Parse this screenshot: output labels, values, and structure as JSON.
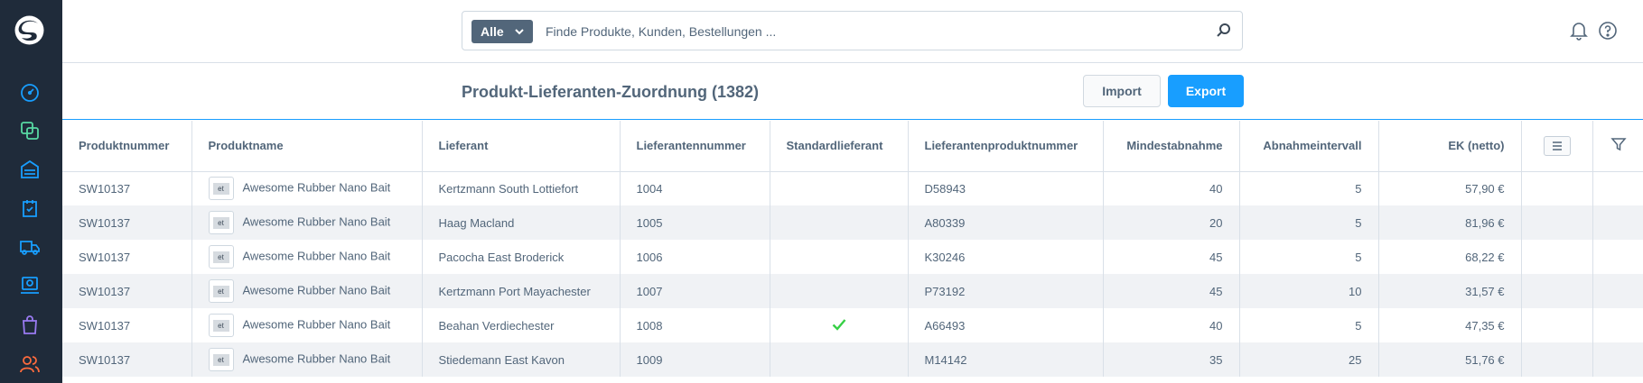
{
  "search": {
    "type_label": "Alle",
    "placeholder": "Finde Produkte, Kunden, Bestellungen ..."
  },
  "icons": {
    "logo": "shopware-logo",
    "nav": [
      "dashboard-icon",
      "catalogue-icon",
      "orders-icon",
      "customers-icon",
      "shipping-icon",
      "content-icon",
      "marketing-icon",
      "users-icon"
    ],
    "top": [
      "bell-icon",
      "help-icon"
    ]
  },
  "colors": {
    "sidebar": "#1f2b3a",
    "accent": "#189eff",
    "check": "#37d046",
    "text": "#52667a"
  },
  "header": {
    "title": "Produkt-Lieferanten-Zuordnung (1382)",
    "import_label": "Import",
    "export_label": "Export"
  },
  "table": {
    "columns": [
      "Produktnummer",
      "Produktname",
      "Lieferant",
      "Lieferantennummer",
      "Standardlieferant",
      "Lieferantenproduktnummer",
      "Mindestabnahme",
      "Abnahmeintervall",
      "EK (netto)"
    ],
    "rows": [
      {
        "nr": "SW10137",
        "thumb": "et",
        "name": "Awesome Rubber Nano Bait",
        "supplier": "Kertzmann South Lottiefort",
        "supplier_nr": "1004",
        "default": false,
        "supplier_product_nr": "D58943",
        "min": "40",
        "interval": "5",
        "price": "57,90 €"
      },
      {
        "nr": "SW10137",
        "thumb": "et",
        "name": "Awesome Rubber Nano Bait",
        "supplier": "Haag Macland",
        "supplier_nr": "1005",
        "default": false,
        "supplier_product_nr": "A80339",
        "min": "20",
        "interval": "5",
        "price": "81,96 €"
      },
      {
        "nr": "SW10137",
        "thumb": "et",
        "name": "Awesome Rubber Nano Bait",
        "supplier": "Pacocha East Broderick",
        "supplier_nr": "1006",
        "default": false,
        "supplier_product_nr": "K30246",
        "min": "45",
        "interval": "5",
        "price": "68,22 €"
      },
      {
        "nr": "SW10137",
        "thumb": "et",
        "name": "Awesome Rubber Nano Bait",
        "supplier": "Kertzmann Port Mayachester",
        "supplier_nr": "1007",
        "default": false,
        "supplier_product_nr": "P73192",
        "min": "45",
        "interval": "10",
        "price": "31,57 €"
      },
      {
        "nr": "SW10137",
        "thumb": "et",
        "name": "Awesome Rubber Nano Bait",
        "supplier": "Beahan Verdiechester",
        "supplier_nr": "1008",
        "default": true,
        "supplier_product_nr": "A66493",
        "min": "40",
        "interval": "5",
        "price": "47,35 €"
      },
      {
        "nr": "SW10137",
        "thumb": "et",
        "name": "Awesome Rubber Nano Bait",
        "supplier": "Stiedemann East Kavon",
        "supplier_nr": "1009",
        "default": false,
        "supplier_product_nr": "M14142",
        "min": "35",
        "interval": "25",
        "price": "51,76 €"
      }
    ]
  }
}
